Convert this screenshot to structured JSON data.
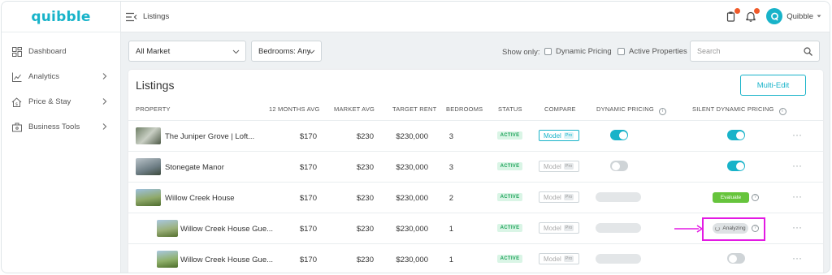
{
  "app": {
    "logo_text": "quibble"
  },
  "sidebar": {
    "items": [
      {
        "label": "Dashboard",
        "icon": "dashboard-icon",
        "has_chevron": false
      },
      {
        "label": "Analytics",
        "icon": "chart-icon",
        "has_chevron": true
      },
      {
        "label": "Price & Stay",
        "icon": "home-price-icon",
        "has_chevron": true
      },
      {
        "label": "Business Tools",
        "icon": "briefcase-icon",
        "has_chevron": true
      }
    ]
  },
  "topbar": {
    "breadcrumb": "Listings",
    "user_name": "Quibble"
  },
  "filters": {
    "market_select": "All Market",
    "bedrooms_select": "Bedrooms: Any",
    "show_only_label": "Show only:",
    "dynamic_pricing_label": "Dynamic Pricing",
    "active_properties_label": "Active Properties",
    "search_placeholder": "Search"
  },
  "listings": {
    "title": "Listings",
    "multi_edit_label": "Multi-Edit",
    "columns": {
      "property": "PROPERTY",
      "avg12": "12 MONTHS AVG",
      "market_avg": "MARKET AVG",
      "target_rent": "TARGET RENT",
      "bedrooms": "BEDROOMS",
      "status": "STATUS",
      "compare": "COMPARE",
      "dynamic_pricing": "DYNAMIC PRICING",
      "silent_dynamic_pricing": "SILENT DYNAMIC PRICING"
    },
    "rows": [
      {
        "name": "The Juniper Grove | Loft...",
        "avg12": "$170",
        "market_avg": "$230",
        "target_rent": "$230,000",
        "bedrooms": "3",
        "status": "ACTIVE",
        "compare": "Model",
        "compare_tag": "Pro"
      },
      {
        "name": "Stonegate Manor",
        "avg12": "$170",
        "market_avg": "$230",
        "target_rent": "$230,000",
        "bedrooms": "3",
        "status": "ACTIVE",
        "compare": "Model",
        "compare_tag": "Pro"
      },
      {
        "name": "Willow Creek House",
        "avg12": "$170",
        "market_avg": "$230",
        "target_rent": "$230,000",
        "bedrooms": "2",
        "status": "ACTIVE",
        "compare": "Model",
        "compare_tag": "Pro",
        "silent_action": "Evaluate"
      },
      {
        "name": "Willow Creek House Gue...",
        "avg12": "$170",
        "market_avg": "$230",
        "target_rent": "$230,000",
        "bedrooms": "1",
        "status": "ACTIVE",
        "compare": "Model",
        "compare_tag": "Pro",
        "silent_action": "Analyzing"
      },
      {
        "name": "Willow Creek House Gue...",
        "avg12": "$170",
        "market_avg": "$230",
        "target_rent": "$230,000",
        "bedrooms": "1",
        "status": "ACTIVE",
        "compare": "Model",
        "compare_tag": "Pro"
      }
    ],
    "more_symbol": "···",
    "help_symbol": "?",
    "info_symbol": "i"
  },
  "colors": {
    "brand": "#18b3c9",
    "active_green": "#1ea35a",
    "evaluate_green": "#66c43c",
    "highlight": "#e31ae3"
  }
}
